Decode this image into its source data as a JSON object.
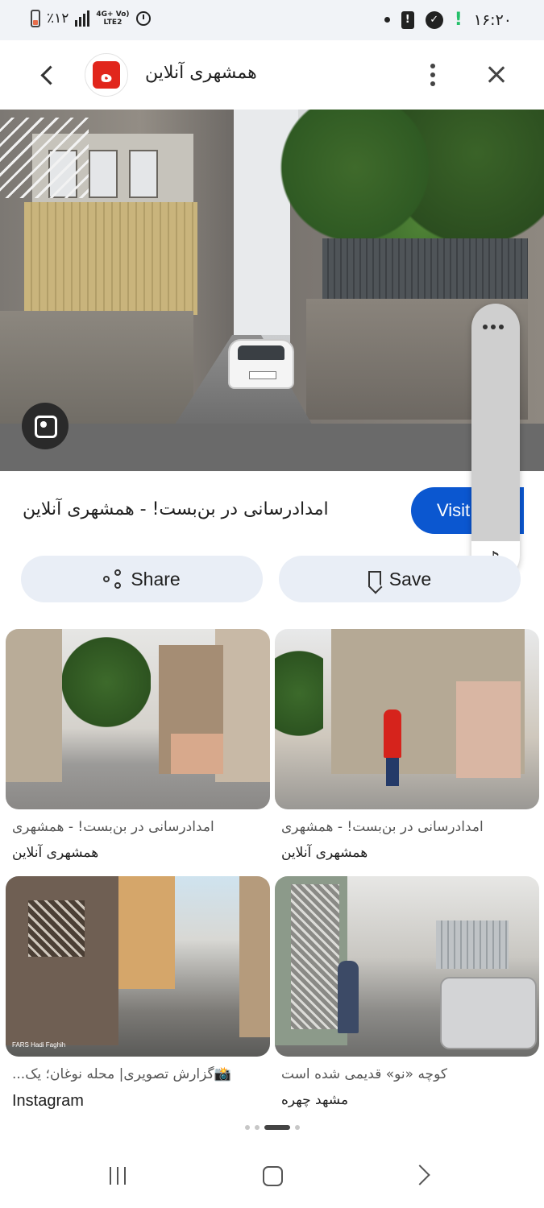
{
  "status_bar": {
    "battery_text": "٪۱۲",
    "network_top": "4G+ Vo)",
    "network_bottom": "LTE2",
    "time": "۱۶:۲۰"
  },
  "header": {
    "logo_glyph": "ه",
    "site_name": "همشهری آنلاین"
  },
  "result": {
    "title": "امدادرسانی در بن‌بست! - همشهری آنلاین",
    "visit_label": "Visit"
  },
  "actions": {
    "share_label": "Share",
    "save_label": "Save"
  },
  "related": [
    {
      "title": "امدادرسانی در بن‌بست! - همشهری",
      "source": "همشهری آنلاین"
    },
    {
      "title": "امدادرسانی در بن‌بست! - همشهری",
      "source": "همشهری آنلاین"
    },
    {
      "title": "📸گزارش تصویری| محله نوغان؛ یک...",
      "source": "Instagram",
      "watermark": "FARS Hadi Faghih"
    },
    {
      "title": "کوچه «نو» قدیمی شده است",
      "source": "مشهد چهره"
    }
  ],
  "pager": {
    "count": 4,
    "active_index": 2
  },
  "colors": {
    "visit_button": "#0b57d0",
    "chip_background": "#e9eef6",
    "logo_red": "#e1261c"
  },
  "icons": [
    "back-icon",
    "more-vert-icon",
    "close-icon",
    "lens-icon",
    "share-icon",
    "bookmark-icon",
    "music-note-icon"
  ]
}
